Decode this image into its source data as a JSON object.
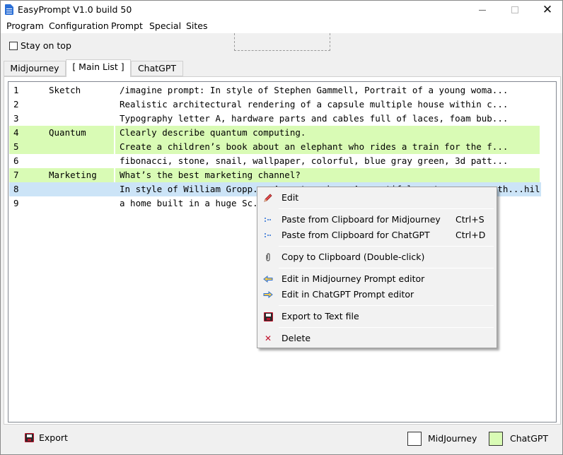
{
  "window": {
    "title": "EasyPrompt V1.0 build 50"
  },
  "menu": [
    "Program",
    "Configuration",
    "Prompt",
    "Special",
    "Sites"
  ],
  "toolbar": {
    "stay_on_top_label": "Stay on top",
    "stay_on_top_checked": false
  },
  "tabs": [
    "Midjourney",
    "[ Main List ]",
    "ChatGPT"
  ],
  "active_tab": "[ Main List ]",
  "rows": [
    {
      "num": "1",
      "category": "Sketch",
      "text": "/imagine prompt: In style of Stephen Gammell, Portrait of a young woma...",
      "type": "midjourney",
      "selected": false
    },
    {
      "num": "2",
      "category": "",
      "text": "Realistic architectural rendering of a capsule multiple house within c...",
      "type": "midjourney",
      "selected": false
    },
    {
      "num": "3",
      "category": "",
      "text": "Typography letter A, hardware parts and cables full of laces, foam bub...",
      "type": "midjourney",
      "selected": false
    },
    {
      "num": "4",
      "category": "Quantum",
      "text": "Clearly describe quantum computing.",
      "type": "chatgpt",
      "selected": false
    },
    {
      "num": "5",
      "category": "",
      "text": "Create a children’s book about an elephant who rides a train for the f...",
      "type": "chatgpt",
      "selected": false
    },
    {
      "num": "6",
      "category": "",
      "text": "fibonacci, stone, snail, wallpaper, colorful, blue gray green, 3d patt...",
      "type": "midjourney",
      "selected": false
    },
    {
      "num": "7",
      "category": "Marketing",
      "text": "What’s the best marketing channel?",
      "type": "chatgpt",
      "selected": false
    },
    {
      "num": "8",
      "category": "",
      "text": "In style of William Gropp... A ...t...ph... A ...utiful ...t... ... ...th...hil...",
      "type": "midjourney",
      "selected": true
    },
    {
      "num": "9",
      "category": "",
      "text": "a home built in a huge Sc...                                  ...s, ...",
      "type": "midjourney",
      "selected": false
    }
  ],
  "context_menu": {
    "edit": "Edit",
    "paste_mj": "Paste from Clipboard for Midjourney",
    "paste_mj_shortcut": "Ctrl+S",
    "paste_gpt": "Paste from Clipboard for ChatGPT",
    "paste_gpt_shortcut": "Ctrl+D",
    "copy": "Copy to Clipboard (Double-click)",
    "edit_mj": "Edit in Midjourney Prompt editor",
    "edit_gpt": "Edit in ChatGPT Prompt editor",
    "export_text": "Export to Text file",
    "delete": "Delete"
  },
  "footer": {
    "export_label": "Export",
    "legend_midjourney": "MidJourney",
    "legend_chatgpt": "ChatGPT",
    "color_midjourney": "#ffffff",
    "color_chatgpt": "#d9fbb5"
  },
  "colors": {
    "selected_row": "#cce4f7",
    "chatgpt_row": "#d9fbb5",
    "delete_icon": "#c0122b",
    "arrow_icon": "#2b6fd6"
  },
  "icons": {
    "edit": "pencil-icon",
    "paste": "paste-dots-icon",
    "copy": "paperclip-icon",
    "edit_mj": "arrow-left-icon",
    "edit_gpt": "arrow-right-icon",
    "export": "floppy-disk-icon",
    "delete": "delete-x-icon"
  }
}
